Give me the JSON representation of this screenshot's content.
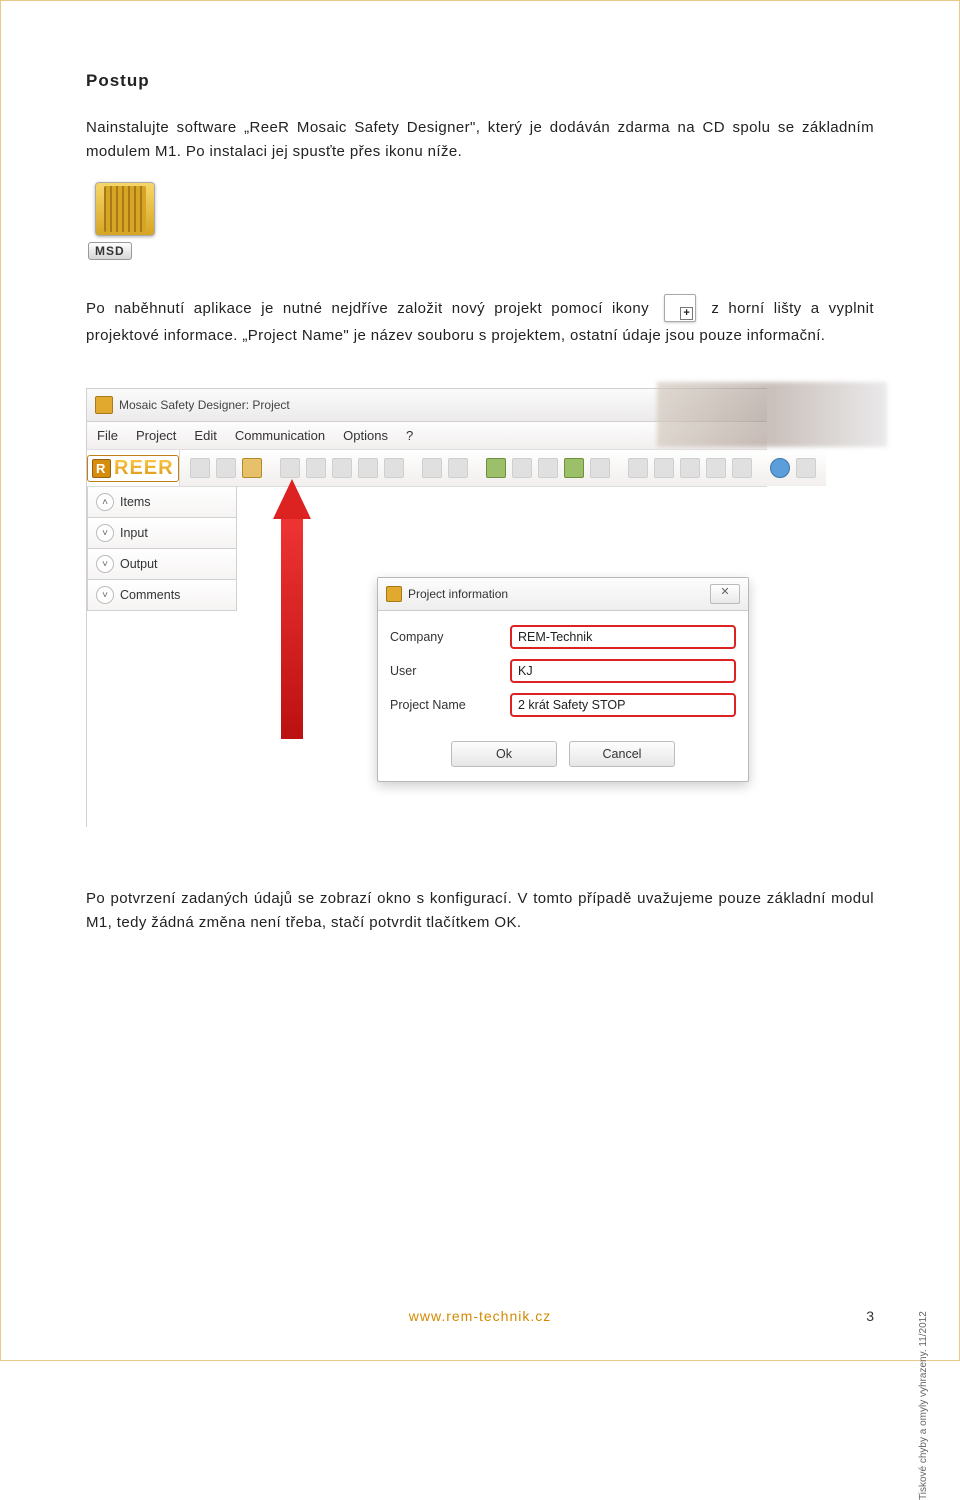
{
  "heading": "Postup",
  "para1": "Nainstalujte software „ReeR Mosaic Safety Designer\", který je dodáván zdarma na CD spolu se základním modulem M1. Po instalaci jej spusťte přes ikonu níže.",
  "msd_label": "MSD",
  "para2_a": "Po naběhnutí aplikace je nutné nejdříve založit nový projekt pomocí ikony",
  "para2_b": "z horní lišty a vyplnit projektové informace. „Project Name\" je název souboru s projektem, ostatní údaje jsou pouze informační.",
  "screenshot": {
    "window_title": "Mosaic Safety Designer: Project",
    "menus": [
      "File",
      "Project",
      "Edit",
      "Communication",
      "Options",
      "?"
    ],
    "logo": "REER",
    "sidebar": {
      "items": [
        {
          "label": "Items",
          "chev": "˄"
        },
        {
          "label": "Input",
          "chev": "˅"
        },
        {
          "label": "Output",
          "chev": "˅"
        },
        {
          "label": "Comments",
          "chev": "˅"
        }
      ]
    },
    "dialog": {
      "title": "Project information",
      "close": "✕",
      "fields": {
        "company_label": "Company",
        "company_value": "REM-Technik",
        "user_label": "User",
        "user_value": "KJ",
        "project_label": "Project Name",
        "project_value": "2 krát Safety STOP"
      },
      "ok": "Ok",
      "cancel": "Cancel"
    }
  },
  "para3": "Po potvrzení zadaných údajů se zobrazí okno s konfigurací. V tomto případě uvažujeme pouze základní modul M1, tedy žádná změna není třeba, stačí potvrdit tlačítkem OK.",
  "footer_url": "www.rem-technik.cz",
  "page_number": "3",
  "side_note": "Tiskové chyby a omyly vyhrazeny. 11/2012"
}
